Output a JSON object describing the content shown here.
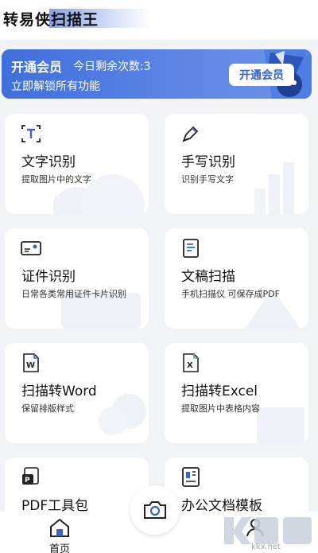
{
  "header": {
    "app_title": "转易侠扫描王"
  },
  "vip_banner": {
    "title": "开通会员",
    "remaining": "今日剩余次数:3",
    "subtitle": "立即解锁所有功能",
    "button_label": "开通会员"
  },
  "features": [
    {
      "title": "文字识别",
      "desc": "提取图片中的文字",
      "icon": "text-recognition-icon"
    },
    {
      "title": "手写识别",
      "desc": "识别手写文字",
      "icon": "pen-icon"
    },
    {
      "title": "证件识别",
      "desc": "日常各类常用证件卡片识别",
      "icon": "id-card-icon"
    },
    {
      "title": "文稿扫描",
      "desc": "手机扫描仪 可保存成PDF",
      "icon": "document-icon"
    },
    {
      "title": "扫描转Word",
      "desc": "保留排版样式",
      "icon": "word-icon"
    },
    {
      "title": "扫描转Excel",
      "desc": "提取图片中表格内容",
      "icon": "excel-icon"
    },
    {
      "title": "PDF工具包",
      "desc": "",
      "icon": "pdf-icon"
    },
    {
      "title": "办公文档模板",
      "desc": "",
      "icon": "template-icon"
    }
  ],
  "bottom_nav": {
    "home_label": "首页",
    "camera": "camera-icon",
    "mine": "user-icon"
  },
  "watermark": {
    "text": "kkx.net"
  },
  "colors": {
    "banner": "#3f6fdc",
    "accent": "#2f5fcf",
    "icon_blue": "#3b63c9"
  }
}
